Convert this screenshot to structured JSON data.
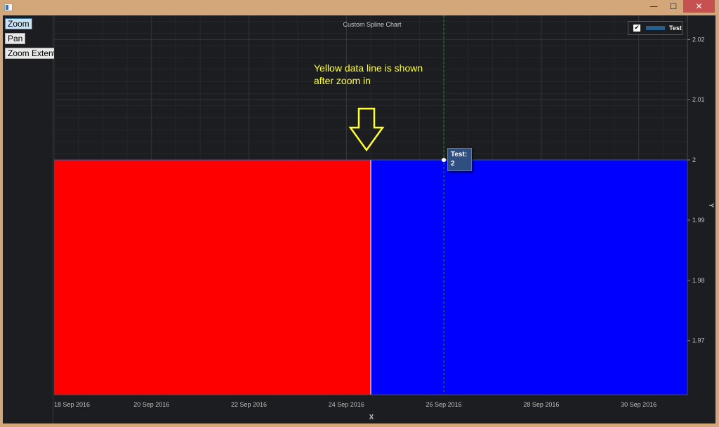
{
  "window": {
    "minimize_icon": "minimize-icon",
    "maximize_icon": "maximize-icon",
    "close_icon": "close-icon",
    "minimize_glyph": "—",
    "maximize_glyph": "☐",
    "close_glyph": "✕"
  },
  "toolbar": {
    "zoom_label": "Zoom",
    "pan_label": "Pan",
    "zoom_extents_label": "Zoom Extents"
  },
  "annotation": {
    "line1": "Yellow data line is shown",
    "line2": "after zoom in"
  },
  "tooltip": {
    "series": "Test:",
    "value": "2"
  },
  "legend": {
    "check_glyph": "✔",
    "label": "Test"
  },
  "colors": {
    "region_left": "#ff0000",
    "region_right": "#0000ff",
    "boundary_line": "#ffffff",
    "cursor_line": "#2e8b2e",
    "annotation_text": "#ffff33",
    "arrow_stroke": "#ffff33"
  },
  "chart_data": {
    "type": "area",
    "title": "Custom Spline Chart",
    "xlabel": "X",
    "ylabel": "Y",
    "x_ticks": [
      "18 Sep 2016",
      "20 Sep 2016",
      "22 Sep 2016",
      "24 Sep 2016",
      "26 Sep 2016",
      "28 Sep 2016",
      "30 Sep 2016"
    ],
    "y_ticks": [
      "2.02",
      "2.01",
      "2",
      "1.99",
      "1.98",
      "1.97"
    ],
    "x_range": [
      "2016-09-18",
      "2016-10-01"
    ],
    "ylim": [
      1.961,
      2.024
    ],
    "series": [
      {
        "name": "Test",
        "x": [
          "2016-09-18",
          "2016-09-24T12:00",
          "2016-10-01"
        ],
        "values": [
          2,
          2,
          2
        ]
      }
    ],
    "fill_regions": [
      {
        "color": "red",
        "x_from": "2016-09-18",
        "x_to": "2016-09-24T12:00"
      },
      {
        "color": "blue",
        "x_from": "2016-09-24T12:00",
        "x_to": "2016-10-01"
      }
    ],
    "cursor_x": "2016-09-26",
    "legend_position": "top-right",
    "grid": true
  }
}
